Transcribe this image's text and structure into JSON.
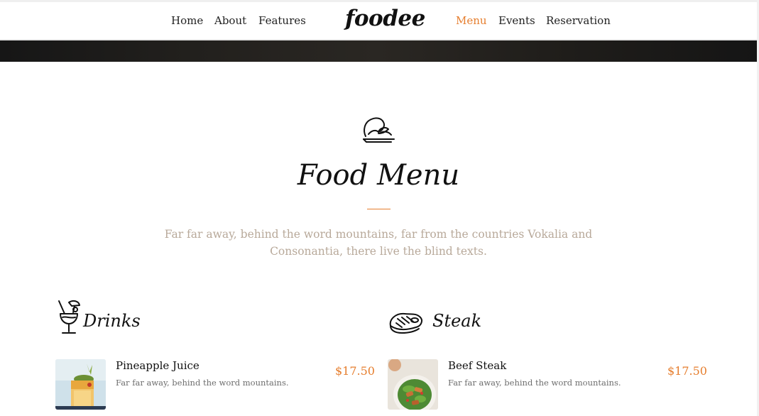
{
  "header": {
    "brand": "foodee",
    "nav_left": [
      "Home",
      "About",
      "Features"
    ],
    "nav_right": [
      "Menu",
      "Events",
      "Reservation"
    ],
    "active_item": "Menu",
    "accent_color": "#e67e2e"
  },
  "section": {
    "icon": "serving-dish-icon",
    "title": "Food Menu",
    "subtitle": "Far far away, behind the word mountains, far from the countries Vokalia and Consonantia, there live the blind texts."
  },
  "categories": [
    {
      "icon": "cocktail-icon",
      "title": "Drinks",
      "items": [
        {
          "name": "Pineapple Juice",
          "description": "Far far away, behind the word mountains.",
          "price": "$17.50",
          "image": "pineapple-juice-photo"
        }
      ]
    },
    {
      "icon": "steak-icon",
      "title": "Steak",
      "items": [
        {
          "name": "Beef Steak",
          "description": "Far far away, behind the word mountains.",
          "price": "$17.50",
          "image": "beef-steak-salad-photo"
        }
      ]
    }
  ]
}
